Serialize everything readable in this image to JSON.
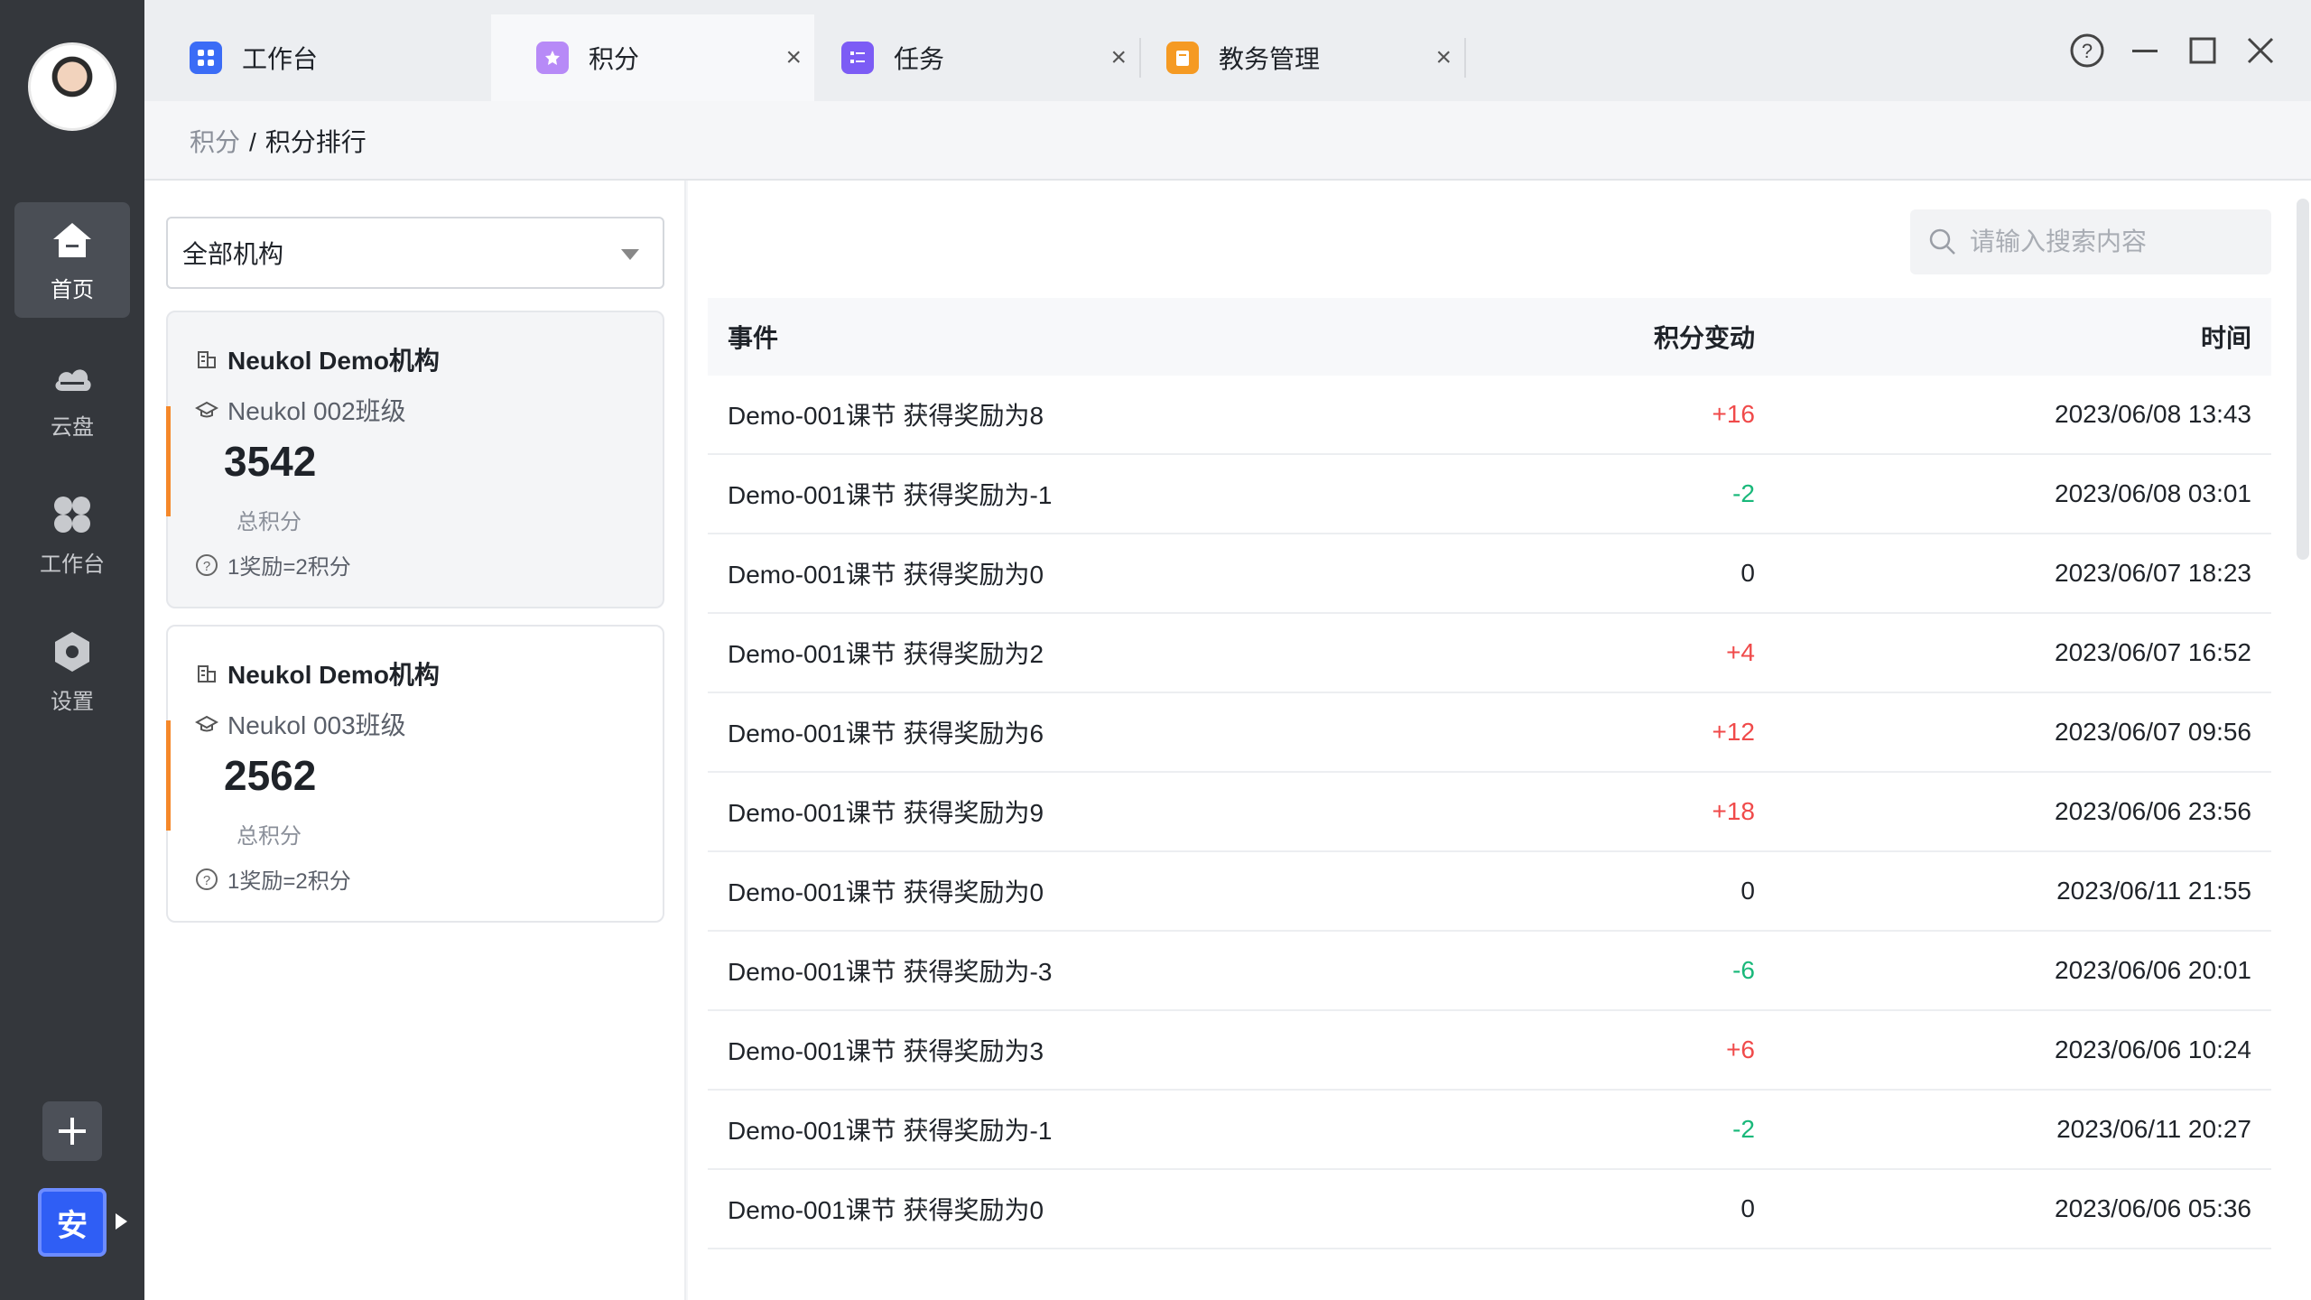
{
  "rail": {
    "items": [
      {
        "label": "首页",
        "icon": "home-icon"
      },
      {
        "label": "云盘",
        "icon": "cloud-icon"
      },
      {
        "label": "工作台",
        "icon": "grid-icon"
      },
      {
        "label": "设置",
        "icon": "settings-icon"
      }
    ],
    "user_badge": "安"
  },
  "tabs": [
    {
      "label": "工作台",
      "icon": "workbench-icon",
      "color": "#3b6cf6"
    },
    {
      "label": "积分",
      "icon": "points-icon",
      "color": "#a874f5"
    },
    {
      "label": "任务",
      "icon": "task-icon",
      "color": "#7c5cf5"
    },
    {
      "label": "教务管理",
      "icon": "edu-icon",
      "color": "#f59a23"
    }
  ],
  "breadcrumb": {
    "parent": "积分",
    "sep": "/",
    "current": "积分排行"
  },
  "filter": {
    "selected": "全部机构"
  },
  "cards": [
    {
      "org": "Neukol Demo机构",
      "class": "Neukol 002班级",
      "total": "3542",
      "caption": "总积分",
      "rule": "1奖励=2积分"
    },
    {
      "org": "Neukol Demo机构",
      "class": "Neukol 003班级",
      "total": "2562",
      "caption": "总积分",
      "rule": "1奖励=2积分"
    }
  ],
  "search": {
    "placeholder": "请输入搜索内容"
  },
  "table": {
    "headers": {
      "event": "事件",
      "change": "积分变动",
      "time": "时间"
    },
    "rows": [
      {
        "event": "Demo-001课节 获得奖励为8",
        "change": "+16",
        "time": "2023/06/08 13:43"
      },
      {
        "event": "Demo-001课节 获得奖励为-1",
        "change": "-2",
        "time": "2023/06/08 03:01"
      },
      {
        "event": "Demo-001课节 获得奖励为0",
        "change": "0",
        "time": "2023/06/07 18:23"
      },
      {
        "event": "Demo-001课节 获得奖励为2",
        "change": "+4",
        "time": "2023/06/07 16:52"
      },
      {
        "event": "Demo-001课节 获得奖励为6",
        "change": "+12",
        "time": "2023/06/07 09:56"
      },
      {
        "event": "Demo-001课节 获得奖励为9",
        "change": "+18",
        "time": "2023/06/06 23:56"
      },
      {
        "event": "Demo-001课节 获得奖励为0",
        "change": "0",
        "time": "2023/06/11 21:55"
      },
      {
        "event": "Demo-001课节 获得奖励为-3",
        "change": "-6",
        "time": "2023/06/06 20:01"
      },
      {
        "event": "Demo-001课节 获得奖励为3",
        "change": "+6",
        "time": "2023/06/06 10:24"
      },
      {
        "event": "Demo-001课节 获得奖励为-1",
        "change": "-2",
        "time": "2023/06/11 20:27"
      },
      {
        "event": "Demo-001课节 获得奖励为0",
        "change": "0",
        "time": "2023/06/06 05:36"
      }
    ]
  },
  "colors": {
    "positive": "#f04a4a",
    "negative": "#19b87a",
    "accent": "#f5882a",
    "rail_bg": "#34373c"
  }
}
